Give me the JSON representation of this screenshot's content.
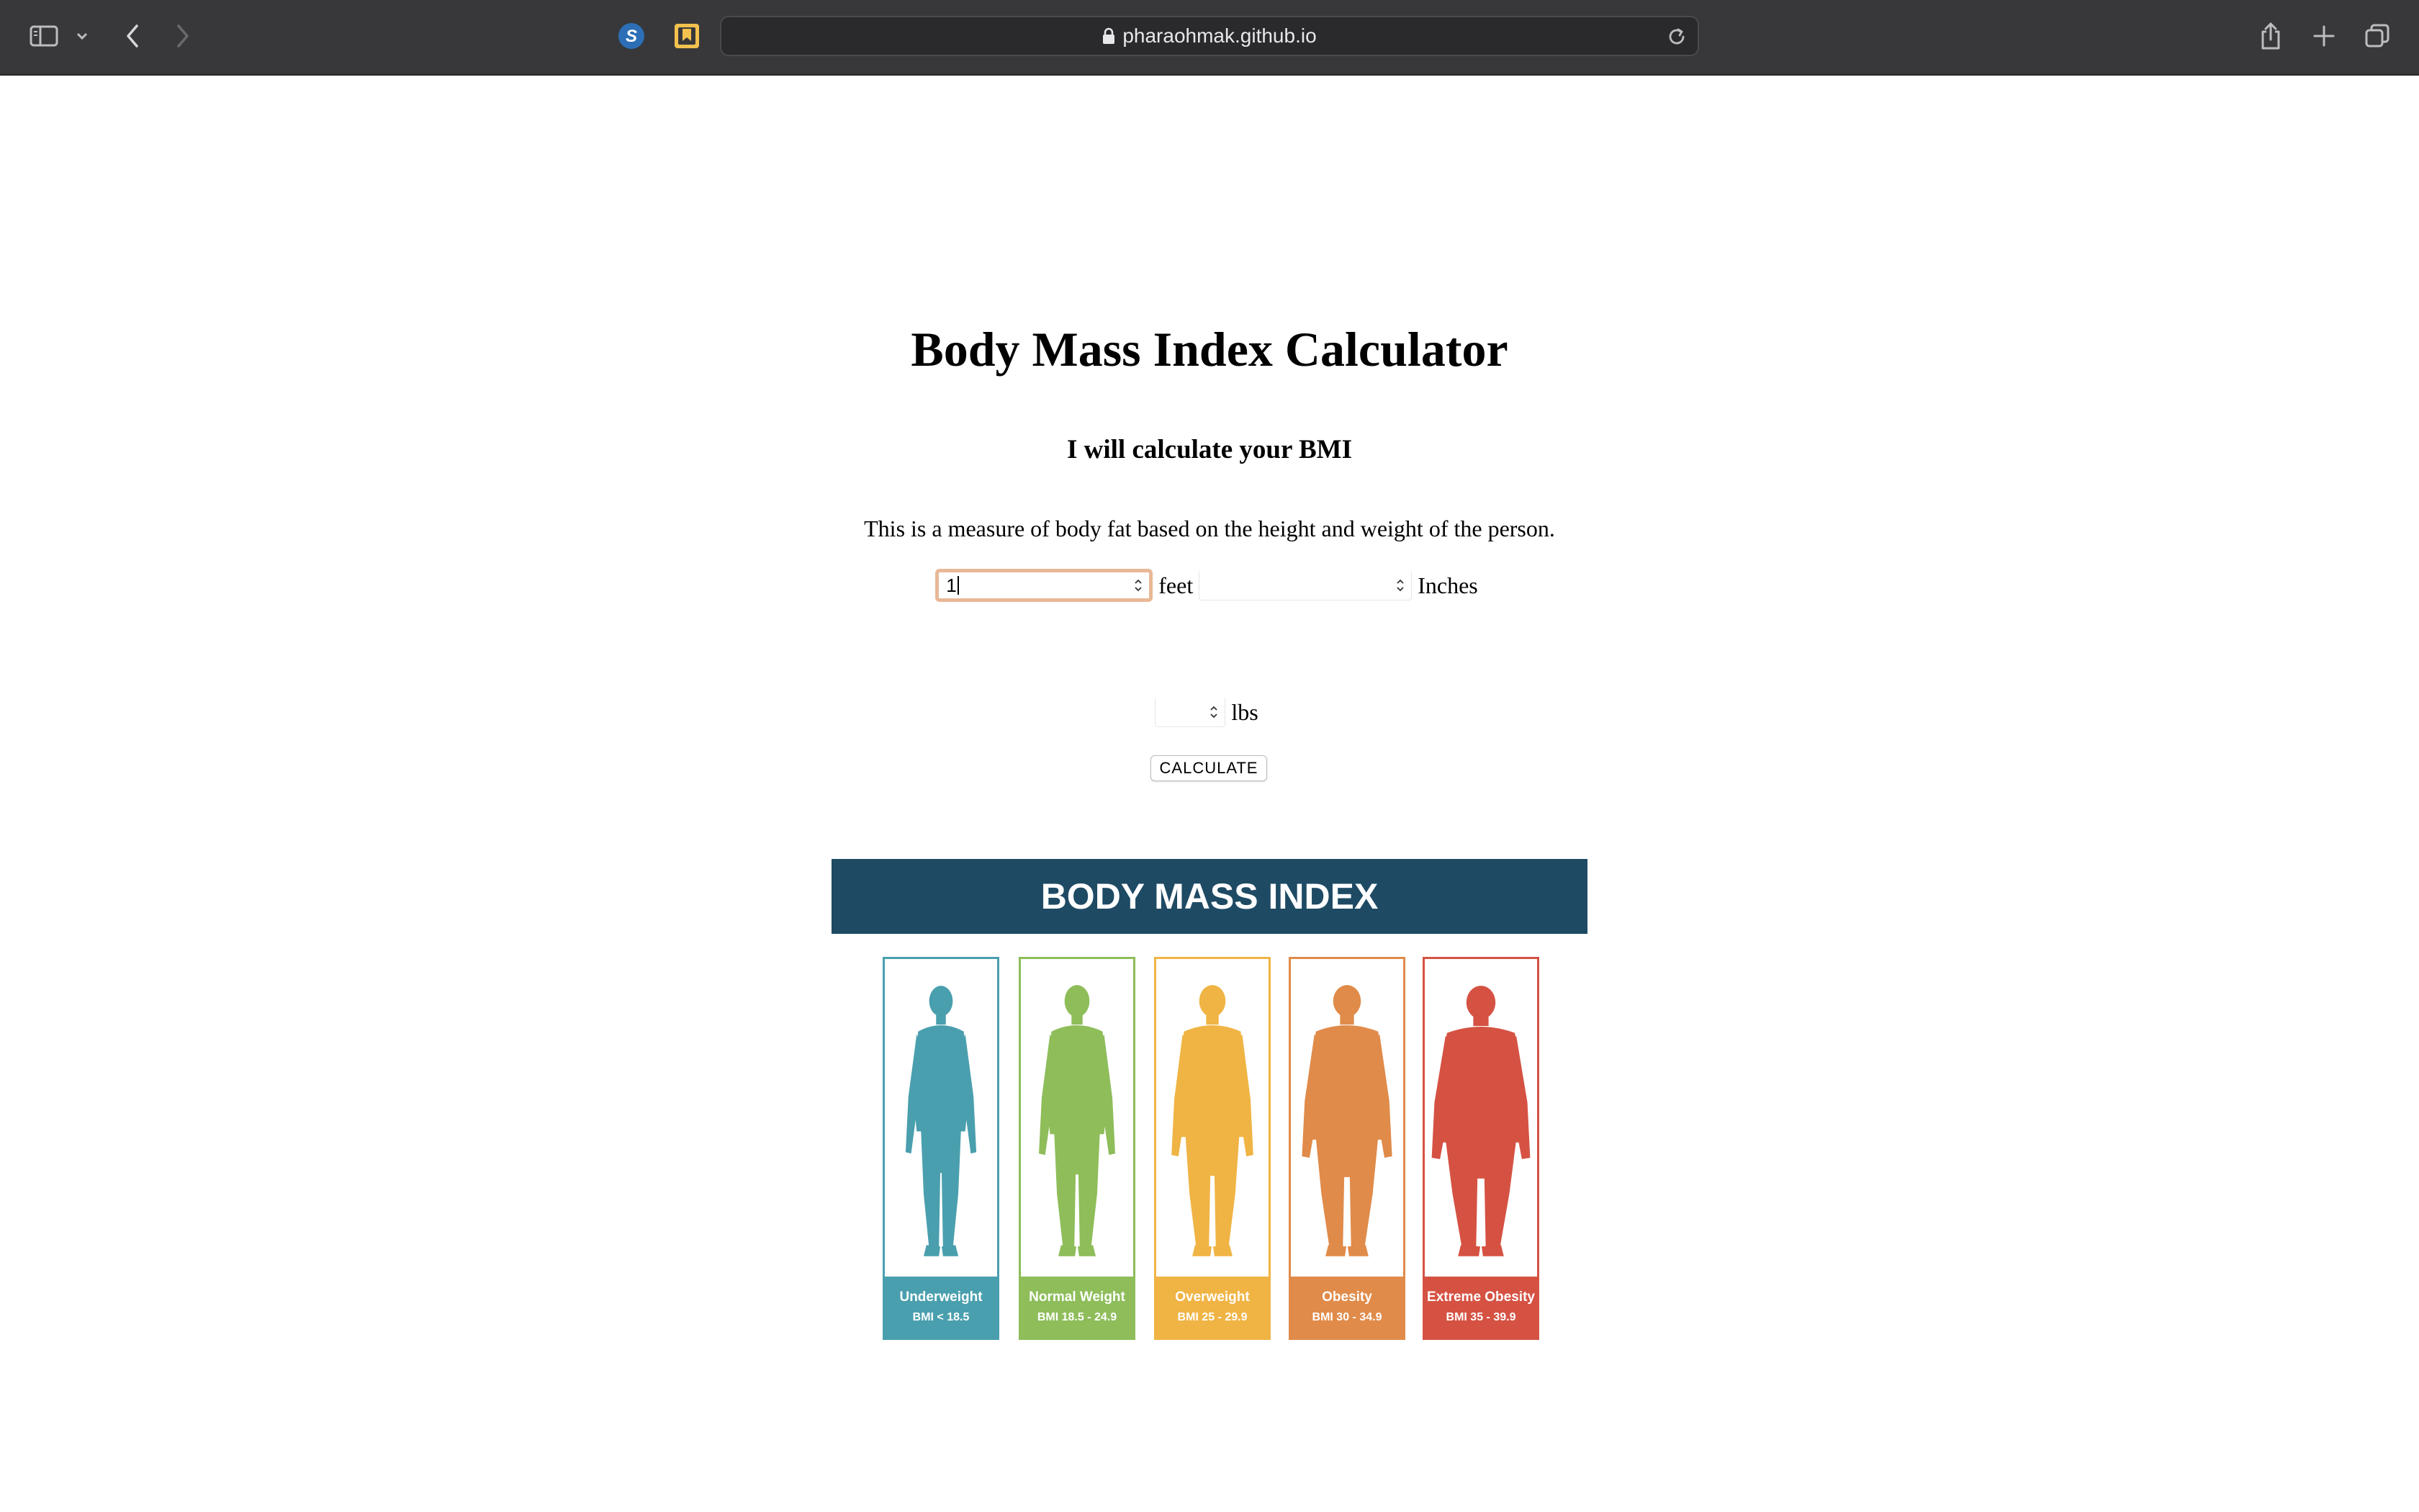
{
  "browser": {
    "url": "pharaohmak.github.io",
    "icons": [
      "sidebar-icon",
      "chevron-down-icon",
      "back-icon",
      "forward-icon",
      "extension-s-icon",
      "bookmark-icon",
      "lock-icon",
      "reload-icon",
      "share-icon",
      "new-tab-icon",
      "tabs-overview-icon"
    ]
  },
  "page": {
    "title": "Body Mass Index Calculator",
    "subtitle": "I will calculate your BMI",
    "description": "This is a measure of body fat based on the height and weight of the person.",
    "form": {
      "feet_value": "1",
      "feet_unit": "feet",
      "inches_value": "",
      "inches_unit": "Inches",
      "weight_value": "",
      "weight_unit": "lbs",
      "calculate_label": "CALCULATE"
    },
    "chart": {
      "banner_title": "BODY MASS INDEX",
      "banner_color": "#1e4a64",
      "categories": [
        {
          "name": "Underweight",
          "range": "BMI < 18.5",
          "color": "#4a9fae"
        },
        {
          "name": "Normal Weight",
          "range": "BMI 18.5 - 24.9",
          "color": "#8ebd5a"
        },
        {
          "name": "Overweight",
          "range": "BMI 25 - 29.9",
          "color": "#f0b444"
        },
        {
          "name": "Obesity",
          "range": "BMI 30 - 34.9",
          "color": "#e08b4a"
        },
        {
          "name": "Extreme Obesity",
          "range": "BMI 35 - 39.9",
          "color": "#d55243"
        }
      ]
    }
  }
}
